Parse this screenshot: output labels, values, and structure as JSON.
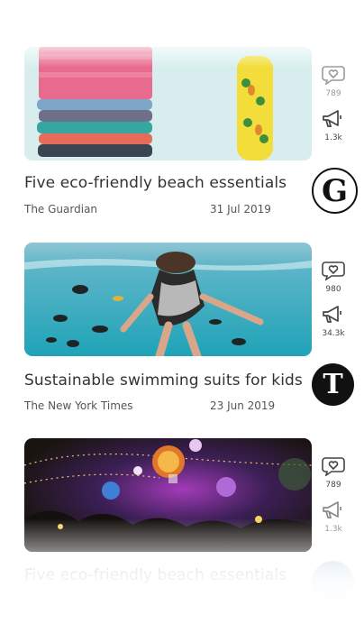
{
  "articles": [
    {
      "title": "Five eco-friendly beach essentials",
      "source": "The Guardian",
      "date": "31 Jul 2019",
      "likes": "789",
      "shares": "1.3k",
      "logo_letter": "G"
    },
    {
      "title": "Sustainable swimming suits for kids",
      "source": "The New York Times",
      "date": "23 Jun 2019",
      "likes": "980",
      "shares": "34.3k",
      "logo_letter": "T"
    },
    {
      "title": "",
      "source": "",
      "date": "",
      "likes": "789",
      "shares": "1.3k",
      "logo_letter": ""
    },
    {
      "title": "Five eco-friendly beach essentials"
    }
  ],
  "icons": {
    "like": "heart-bubble-icon",
    "share": "megaphone-icon"
  },
  "colors": {
    "text": "#333333",
    "logo_dark": "#111111"
  }
}
